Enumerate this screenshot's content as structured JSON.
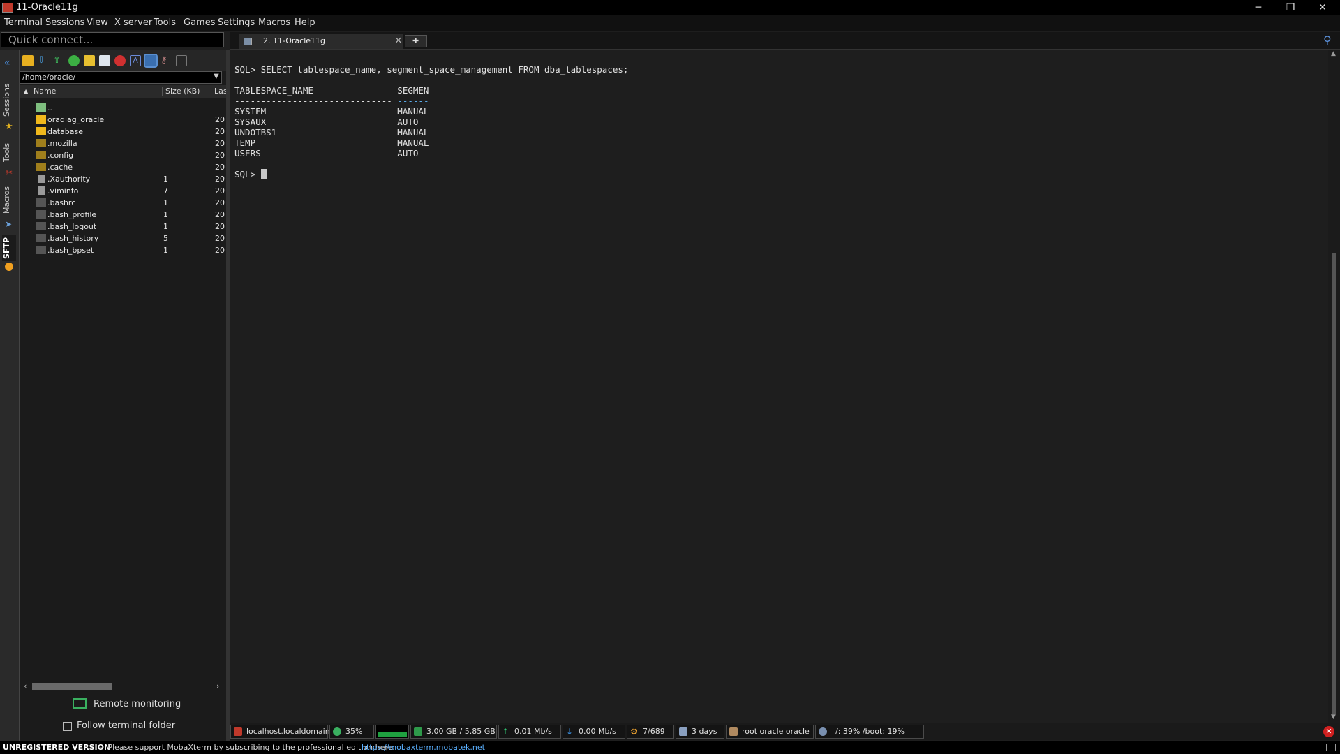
{
  "window": {
    "title": "11-Oracle11g",
    "minimize": "─",
    "restore": "❐",
    "close": "✕"
  },
  "menu": [
    "Terminal",
    "Sessions",
    "View",
    "X server",
    "Tools",
    "Games",
    "Settings",
    "Macros",
    "Help"
  ],
  "quick_connect": {
    "placeholder": "Quick connect..."
  },
  "tabs": [
    {
      "label": "2. 11-Oracle11g",
      "close": "×"
    }
  ],
  "new_tab": "✚",
  "sidebar_tabs": [
    "Sessions",
    "Tools",
    "Macros",
    "SFTP"
  ],
  "sftp": {
    "path": "/home/oracle/",
    "columns": {
      "name": "Name",
      "size": "Size (KB)",
      "last": "Las"
    },
    "files": [
      {
        "name": "..",
        "size": "",
        "last": "",
        "type": "up"
      },
      {
        "name": "oradiag_oracle",
        "size": "",
        "last": "20",
        "type": "folder"
      },
      {
        "name": "database",
        "size": "",
        "last": "20",
        "type": "folder"
      },
      {
        "name": ".mozilla",
        "size": "",
        "last": "20",
        "type": "folder-dim"
      },
      {
        "name": ".config",
        "size": "",
        "last": "20",
        "type": "folder-dim"
      },
      {
        "name": ".cache",
        "size": "",
        "last": "20",
        "type": "folder-dim"
      },
      {
        "name": ".Xauthority",
        "size": "1",
        "last": "20",
        "type": "file"
      },
      {
        "name": ".viminfo",
        "size": "7",
        "last": "20",
        "type": "file"
      },
      {
        "name": ".bashrc",
        "size": "1",
        "last": "20",
        "type": "file-dark"
      },
      {
        "name": ".bash_profile",
        "size": "1",
        "last": "20",
        "type": "file-dark"
      },
      {
        "name": ".bash_logout",
        "size": "1",
        "last": "20",
        "type": "file-dark"
      },
      {
        "name": ".bash_history",
        "size": "5",
        "last": "20",
        "type": "file-dark"
      },
      {
        "name": ".bash_bpset",
        "size": "1",
        "last": "20",
        "type": "file-dark"
      }
    ],
    "remote_monitoring": "Remote monitoring",
    "follow_terminal": "Follow terminal folder"
  },
  "terminal": {
    "query": "SQL> SELECT tablespace_name, segment_space_management FROM dba_tablespaces;",
    "header": "TABLESPACE_NAME                SEGMEN",
    "dashes_name": "------------------------------",
    "dashes_seg": "------",
    "rows": [
      "SYSTEM                         MANUAL",
      "SYSAUX                         AUTO",
      "UNDOTBS1                       MANUAL",
      "TEMP                           MANUAL",
      "USERS                          AUTO"
    ],
    "prompt": "SQL> "
  },
  "status": {
    "host": "localhost.localdomain",
    "cpu": "35%",
    "memory": "3.00 GB / 5.85 GB",
    "upload": "0.01 Mb/s",
    "download": "0.00 Mb/s",
    "sessions": "7/689",
    "uptime": "3 days",
    "users": "root  oracle  oracle",
    "disk": "/: 39%   /boot: 19%"
  },
  "footer": {
    "unregistered": "UNREGISTERED VERSION",
    "message": " -  Please support MobaXterm by subscribing to the professional edition here:",
    "link": "https://mobaxterm.mobatek.net"
  },
  "colors": {
    "folder": "#f0b81c",
    "accent_link": "#5ab0ff",
    "terminal_bg": "#1e1e1e"
  }
}
